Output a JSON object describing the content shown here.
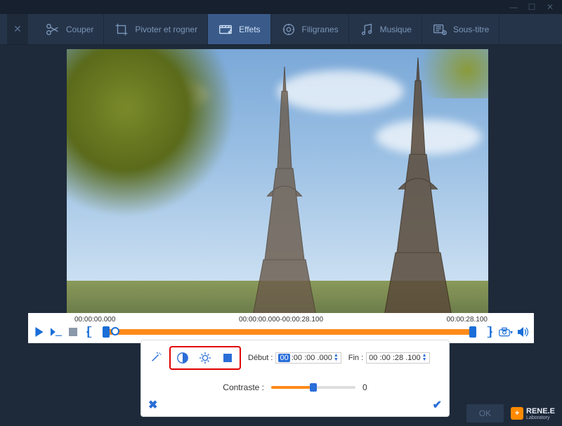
{
  "window": {
    "minimize": "—",
    "maximize": "☐",
    "close_win": "✕"
  },
  "toolbar": {
    "close": "✕",
    "tabs": [
      {
        "label": "Couper"
      },
      {
        "label": "Pivoter et rogner"
      },
      {
        "label": "Effets"
      },
      {
        "label": "Filigranes"
      },
      {
        "label": "Musique"
      },
      {
        "label": "Sous-titre"
      }
    ],
    "active_index": 2
  },
  "timeline": {
    "start": "00:00:00.000",
    "range": "00:00:00.000-00:00:28.100",
    "end": "00:00:28.100"
  },
  "effects": {
    "debut_label": "Début :",
    "debut_value": "00 :00 :00 .000",
    "debut_hl": "00",
    "fin_label": "Fin :",
    "fin_value": "00 :00 :28 .100",
    "contrast_label": "Contraste :",
    "contrast_value": "0"
  },
  "footer": {
    "ok": "OK",
    "brand": "RENE.E",
    "brand_sub": "Laboratory"
  }
}
